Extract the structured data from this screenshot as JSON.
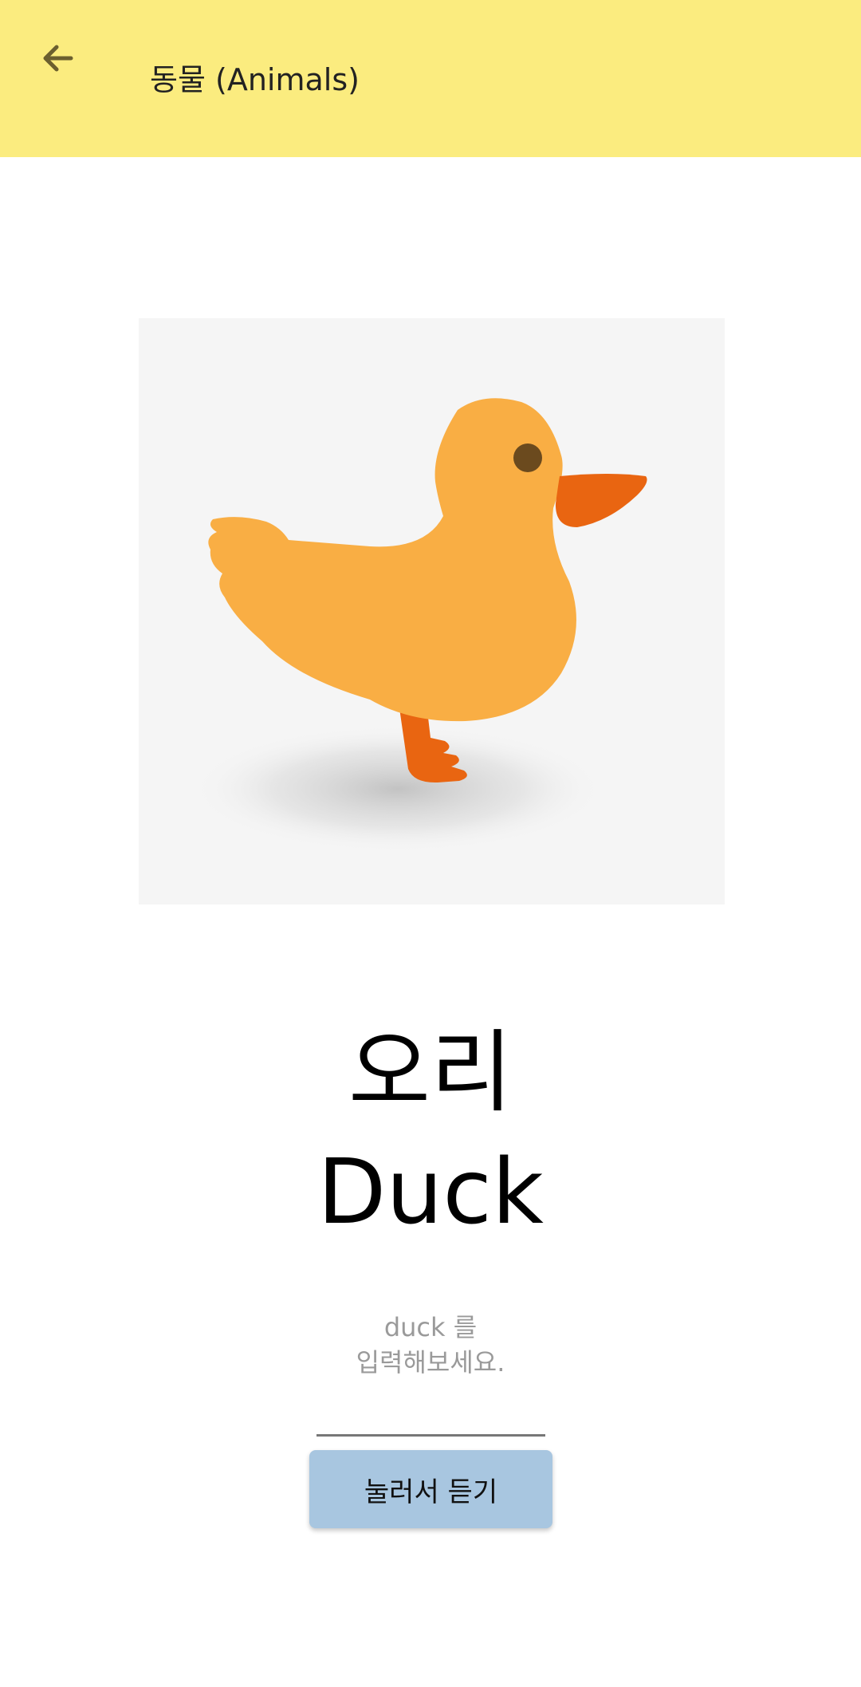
{
  "app_bar": {
    "title": "동물 (Animals)",
    "back_icon": "arrow-left-icon",
    "background_color": "#fbec7f"
  },
  "card": {
    "image_subject": "duck",
    "body_color": "#f9ae44",
    "beak_color": "#e96511"
  },
  "word": {
    "korean": "오리",
    "english": "Duck"
  },
  "quiz": {
    "hint_line1": "duck 를",
    "hint_line2": "입력해보세요.",
    "input_value": ""
  },
  "listen_button": {
    "label": "눌러서 듣기",
    "color": "#a8c6e0"
  }
}
